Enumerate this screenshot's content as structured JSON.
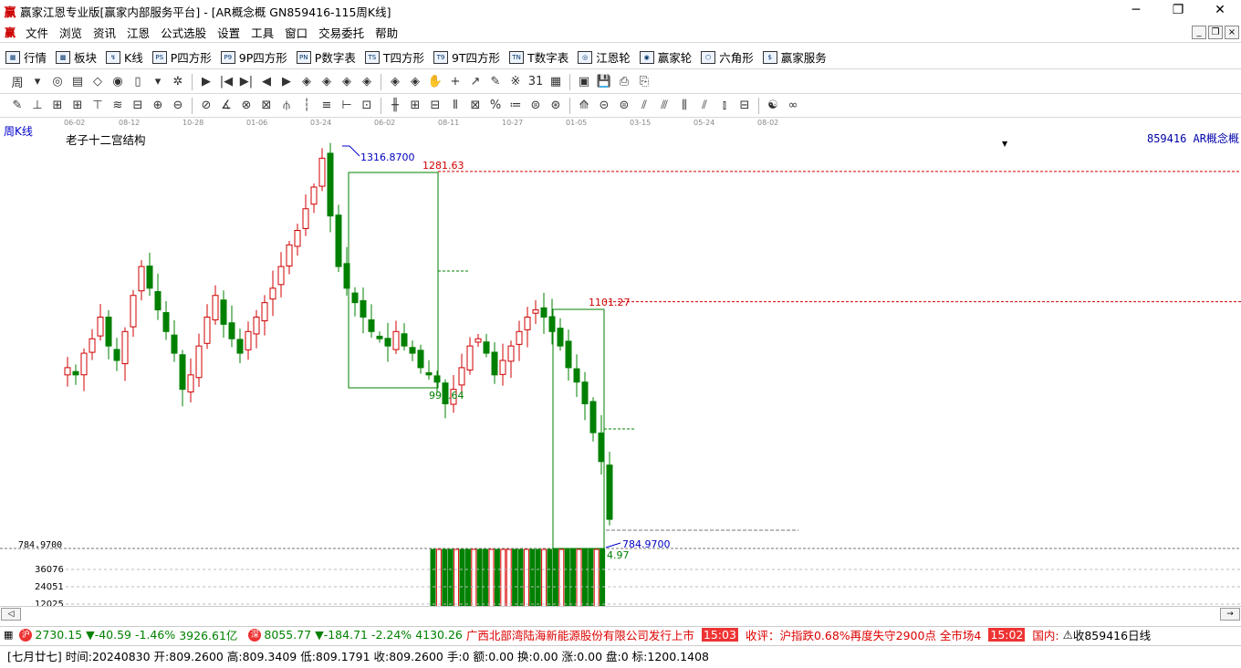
{
  "window": {
    "logo": "赢",
    "title": "赢家江恩专业版[赢家内部服务平台] - [AR概念概   GN859416-115周K线]",
    "minimize": "─",
    "maximize": "❐",
    "close": "✕"
  },
  "menu": {
    "items": [
      "文件",
      "浏览",
      "资讯",
      "江恩",
      "公式选股",
      "设置",
      "工具",
      "窗口",
      "交易委托",
      "帮助"
    ],
    "mdi": [
      "_",
      "❐",
      "×"
    ]
  },
  "toolbar1": [
    {
      "label": "行情",
      "icon": "grid-icon",
      "glyph": "▦"
    },
    {
      "label": "板块",
      "icon": "sector-icon",
      "glyph": "▩"
    },
    {
      "label": "K线",
      "icon": "kline-icon",
      "glyph": "↯"
    },
    {
      "label": "P四方形",
      "icon": "p-square-icon",
      "glyph": "PS"
    },
    {
      "label": "9P四方形",
      "icon": "p9-square-icon",
      "glyph": "P9"
    },
    {
      "label": "P数字表",
      "icon": "pn-table-icon",
      "glyph": "PN"
    },
    {
      "label": "T四方形",
      "icon": "t-square-icon",
      "glyph": "TS"
    },
    {
      "label": "9T四方形",
      "icon": "t9-square-icon",
      "glyph": "T9"
    },
    {
      "label": "T数字表",
      "icon": "tn-table-icon",
      "glyph": "TN"
    },
    {
      "label": "江恩轮",
      "icon": "gann-wheel-icon",
      "glyph": "◎"
    },
    {
      "label": "赢家轮",
      "icon": "winner-wheel-icon",
      "glyph": "◉"
    },
    {
      "label": "六角形",
      "icon": "hexagon-icon",
      "glyph": "⬡"
    },
    {
      "label": "赢家服务",
      "icon": "dollar-icon",
      "glyph": "$"
    }
  ],
  "toolbar2": [
    "周",
    "▾",
    "◎",
    "▤",
    "◇",
    "◉",
    "▯",
    "▾",
    "✲",
    "▶",
    "|◀",
    "▶|",
    "◀",
    "▶",
    "◈",
    "◈",
    "◈",
    "◈",
    "◈",
    "◈",
    "✋",
    "+",
    "↗",
    "✎",
    "※",
    "31",
    "▦",
    "▣",
    "💾",
    "⎙",
    "⎘"
  ],
  "toolbar3": [
    "✎",
    "⊥",
    "⊞",
    "⊞",
    "⊤",
    "≋",
    "⊟",
    "⊕",
    "⊖",
    "⊘",
    "∡",
    "⊗",
    "⊠",
    "⫛",
    "┆",
    "≡",
    "⊢",
    "⊡",
    "╫",
    "⊞",
    "⊟",
    "⫴",
    "⊠",
    "%",
    "≔",
    "⊜",
    "⊛",
    "⟰",
    "⊝",
    "⊜",
    "⫽",
    "⫻",
    "⫼",
    "⫽",
    "⫾",
    "⊟",
    "☯",
    "∞"
  ],
  "date_ticks": [
    "06-02",
    "08-12",
    "10-28",
    "01-06",
    "03-24",
    "06-02",
    "08-11",
    "10-27",
    "01-05",
    "03-15",
    "05-24",
    "08-02"
  ],
  "chart_header": {
    "period": "周K线",
    "indicator": "老子十二宫结构",
    "code": "859416 AR概念概",
    "dropdown": "▼"
  },
  "chart_labels": {
    "high": "1316.8700",
    "box1_top": "1281.63",
    "box1_bottom": "996.64",
    "box2_top": "1101.27",
    "low": "784.9700",
    "low_axis": "784.9700",
    "box2_bottom": "4.97",
    "vol_ticks": [
      "36076",
      "24051",
      "12025"
    ]
  },
  "chart_data": {
    "type": "candlestick",
    "price_range": [
      784.97,
      1316.87
    ],
    "high": 1316.87,
    "low": 784.97,
    "levels": [
      1281.63,
      1101.27,
      996.64
    ],
    "volume_ticks": [
      36076,
      24051,
      12025
    ],
    "colors": {
      "up": "#d00000",
      "down": "#008000",
      "level": "#d00000",
      "box": "#008000",
      "label": "#0000c0"
    }
  },
  "ticker": {
    "sh_badge": "沪",
    "sh_index": "2730.15",
    "sh_change": "▼-40.59",
    "sh_pct": "-1.46%",
    "sh_amount": "3926.61亿",
    "sz_badge": "深",
    "sz_index": "8055.77",
    "sz_change": "▼-184.71",
    "sz_pct": "-2.24%",
    "sz_amount": "4130.26",
    "news1": "广西北部湾陆海新能源股份有限公司发行上市",
    "time1": "15:03",
    "news2": "收评：沪指跌0.68%再度失守2900点 全市场4",
    "time2": "15:02",
    "news3": "国内:",
    "right_label": "收859416日线"
  },
  "statusbar": {
    "text": "[七月廿七] 时间:20240830 开:809.2600 高:809.3409 低:809.1791 收:809.2600 手:0 额:0.00 换:0.00 涨:0.00 盘:0 标:1200.1408"
  },
  "scroll": {
    "left": "◁",
    "right": "→"
  }
}
